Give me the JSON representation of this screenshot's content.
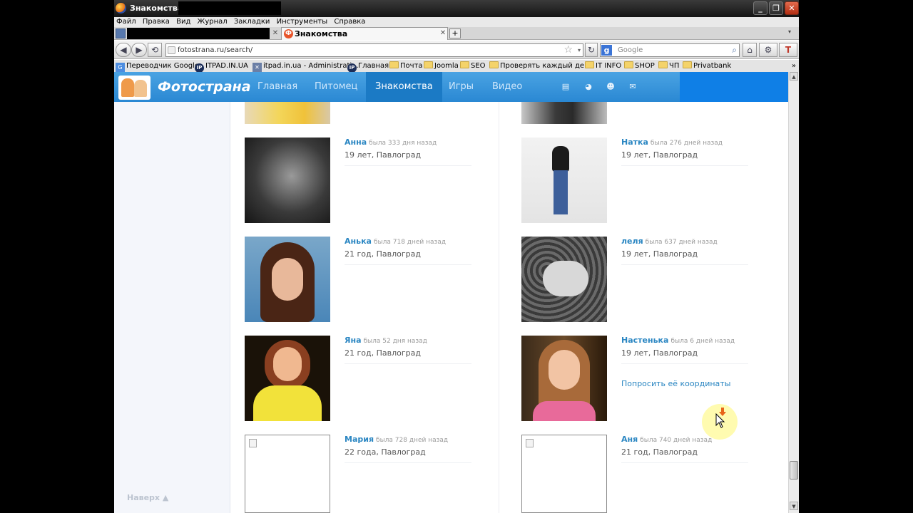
{
  "window": {
    "title": "Знакомства -",
    "controls": [
      "_",
      "❐",
      "✕"
    ]
  },
  "menu": [
    "Файл",
    "Правка",
    "Вид",
    "Журнал",
    "Закладки",
    "Инструменты",
    "Справка"
  ],
  "tabs": {
    "active_label": "Знакомства",
    "new_tab": "+"
  },
  "nav": {
    "url": "fotostrana.ru/search/",
    "search_placeholder": "Google"
  },
  "bookmarks": [
    {
      "label": "Переводчик Google",
      "icon": "translate-icon"
    },
    {
      "label": "ITPAD.IN.UA",
      "icon": "ip-icon"
    },
    {
      "label": "itpad.in.ua - Administrati...",
      "icon": "tools-icon"
    },
    {
      "label": "Главная",
      "icon": "ip-icon"
    },
    {
      "label": "Почта",
      "icon": "folder-icon"
    },
    {
      "label": "Joomla",
      "icon": "folder-icon"
    },
    {
      "label": "SEO",
      "icon": "folder-icon"
    },
    {
      "label": "Проверять каждый де...",
      "icon": "folder-icon"
    },
    {
      "label": "IT INFO",
      "icon": "folder-icon"
    },
    {
      "label": "SHOP",
      "icon": "folder-icon"
    },
    {
      "label": "ЧП",
      "icon": "folder-icon"
    },
    {
      "label": "Privatbank",
      "icon": "folder-icon"
    }
  ],
  "site": {
    "logo": "Фотострана",
    "nav": [
      "Главная",
      "Питомец",
      "Знакомства",
      "Игры",
      "Видео"
    ],
    "active_nav": "Знакомства",
    "back_to_top": "Наверх ▲"
  },
  "profiles": [
    {
      "name": "Анна",
      "seen": "была 333 дня назад",
      "age_city": "19 лет, Павлоград",
      "photo": "bw-girl"
    },
    {
      "name": "Натка",
      "seen": "была 276 дней назад",
      "age_city": "19 лет, Павлоград",
      "photo": "standing-girl"
    },
    {
      "name": "Анька",
      "seen": "была 718 дней назад",
      "age_city": "21 год, Павлоград",
      "photo": "bangs-girl"
    },
    {
      "name": "леля",
      "seen": "была 637 дней назад",
      "age_city": "19 лет, Павлоград",
      "photo": "bw-lying"
    },
    {
      "name": "Яна",
      "seen": "была 52 дня назад",
      "age_city": "21 год, Павлоград",
      "photo": "yellow-shirt"
    },
    {
      "name": "Настенька",
      "seen": "была 6 дней назад",
      "age_city": "19 лет, Павлоград",
      "photo": "pink-top",
      "action": "Попросить её координаты"
    },
    {
      "name": "Мария",
      "seen": "была 728 дней назад",
      "age_city": "22 года, Павлоград",
      "photo": "empty"
    },
    {
      "name": "Аня",
      "seen": "была 740 дней назад",
      "age_city": "21 год, Павлоград",
      "photo": "empty"
    }
  ]
}
